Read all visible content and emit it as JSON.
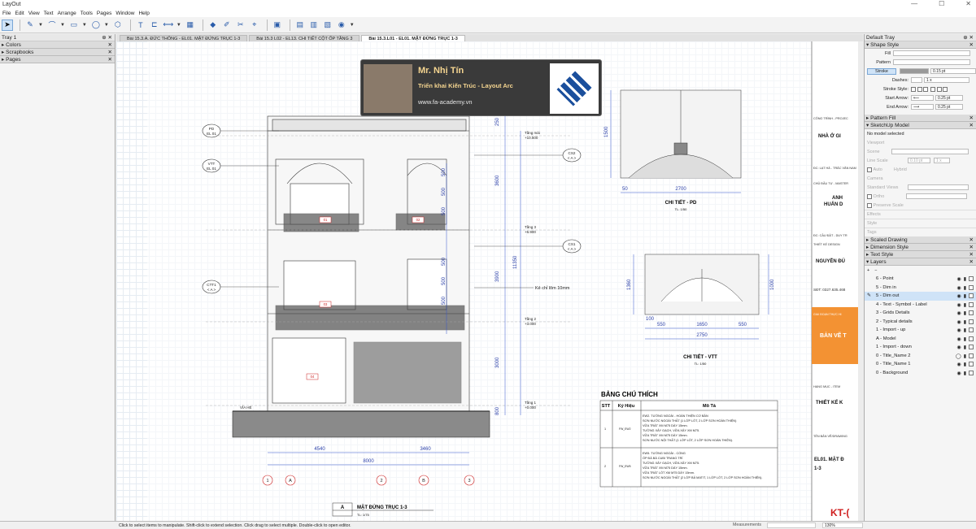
{
  "app": {
    "title": "LayOut",
    "min": "—",
    "max": "☐",
    "close": "✕"
  },
  "menu": [
    "File",
    "Edit",
    "View",
    "Text",
    "Arrange",
    "Tools",
    "Pages",
    "Window",
    "Help"
  ],
  "tray1": {
    "title": "Tray 1",
    "panels": [
      "Colors",
      "Scrapbooks",
      "Pages"
    ]
  },
  "tabs": [
    "Bài 15.3.A. ĐỨC THÔNG - EL01. MẶT ĐỨNG TRỤC 1-3",
    "Bài 15.3 L02 - EL13. CHI TIẾT CỘT ỐP TẦNG 3",
    "Bài 15.3.L01 - EL01. MẶT ĐỨNG TRỤC 1-3"
  ],
  "banner": {
    "name": "Mr. Nhị Tín",
    "role": "Triển khai Kiến Trúc - Layout Arc",
    "site": "www.fa-academy.vn"
  },
  "drawing": {
    "grid_bubbles": [
      {
        "label": "PD",
        "sub": "EL 01"
      },
      {
        "label": "VTT",
        "sub": "EL 01"
      },
      {
        "label": "CTT1",
        "sub": "< A >"
      },
      {
        "label": "CS2",
        "sub": "< A >"
      },
      {
        "label": "CS1",
        "sub": "< A >"
      }
    ],
    "levels": [
      {
        "name": "Tầng mái",
        "val": "+10.500"
      },
      {
        "name": "Tầng 3",
        "val": "+6.900"
      },
      {
        "name": "Tầng 2",
        "val": "+3.000"
      },
      {
        "name": "Tầng 1",
        "val": "+0.000"
      }
    ],
    "vertical_dims": [
      "3600",
      "3900",
      "3000",
      "800",
      "11350",
      "250"
    ],
    "window_dims": [
      "500",
      "500",
      "500",
      "500",
      "500",
      "500"
    ],
    "bottom_dims": [
      "4540",
      "3460",
      "8000"
    ],
    "axes": [
      "1",
      "A",
      "2",
      "B",
      "3"
    ],
    "tags": [
      "01",
      "02",
      "03",
      "04"
    ],
    "callout": "Kẻ chỉ lõm 10mm",
    "via_he": "VỈA HÈ",
    "title_block": {
      "letter": "A",
      "name": "MẶT ĐỨNG TRỤC 1-3",
      "scale": "TL: 1/75"
    },
    "pd": {
      "dim_h": "2700",
      "dim_v": "1500",
      "dim_l": "50",
      "title": "CHI TIẾT - PD",
      "scale": "TL: 1/50"
    },
    "vtt": {
      "dims": [
        "550",
        "1650",
        "550"
      ],
      "total": "2750",
      "dim_v": "1360",
      "dim_r": "1000",
      "dim_b": "100",
      "title": "CHI TIẾT - VTT",
      "scale": "TL: 1/50"
    },
    "legend": {
      "title": "BẢNG CHÚ THÍCH",
      "headers": [
        "STT",
        "Ký Hiệu",
        "Mô Tả"
      ],
      "rows": [
        {
          "stt": "1",
          "code": "FW_EW2",
          "lines": [
            "EW2. TƯỜNG NGOÀI - HOÀN THIỆN CƠ BẢN",
            "SƠN NƯỚC NGOÀI THẤT (1 LỚP LÓT, 2 LỚP SƠN HOÀN THIỆN)",
            "VỮA TRÁT XM M75 DÀY 15mm.",
            "TƯỜNG XÂY GẠCH, VỮA XÂY XM M75.",
            "VỮA TRÁT XM M75 DÀY 15mm.",
            "SƠN NƯỚC NỘI THẤT (1 LỚP LÓT, 2 LỚP SƠN HOÀN THIỆN)."
          ]
        },
        {
          "stt": "2",
          "code": "FW_EW5",
          "lines": [
            "EW5. TƯỜNG NGOÀI - CỔNG",
            "ỐP ĐÁ BÁ CUBI TRANG TRÍ",
            "TƯỜNG XÂY GẠCH, VỮA XÂY XM M75.",
            "VỮA TRÁT XM M75 DÀY 15mm.",
            "VỮA TRÁT LÓT XM M75 DÀY 15mm.",
            "SƠN NƯỚC NGOÀI THẤT (2 LỚP BẢ MATIT, 1 LỚP LÓT, 2 LỚP SƠN HOÀN THIỆN)."
          ]
        }
      ]
    },
    "sheet": {
      "cong_trinh": "CÔNG TRÌNH - PROJEC",
      "nha": "NHÀ Ở GI",
      "addr": "ĐC: LẠT HÀ - TRẮC VĂN NAM",
      "chu_dau_tu": "CHỦ ĐẦU TƯ - MASTER",
      "anh": "ANH",
      "huan": "HUẤN D",
      "dc2": "ĐC: CẦU ĐẬT - DUY TR",
      "tkdesign": "THIẾT KẾ DESIGN",
      "nguyen": "NGUYỄN ĐÚ",
      "sdt": "SĐT: 0327.635.468",
      "giai_doan": "GIAI ĐOẠN THỰC HI",
      "ban_ve": "BẢN VẼ T",
      "hang_muc": "HẠNG MỤC - ITEM",
      "tk": "THIẾT KẾ K",
      "ten_ban_ve": "TÊN BẢN VẼ/DRAWING",
      "el01": "EL01. MẶT Đ",
      "el01b": "1-3",
      "kt": "KT-("
    }
  },
  "tray2": {
    "title": "Default Tray",
    "shape_style": "Shape Style",
    "fill": "Fill",
    "pattern": "Pattern",
    "stroke": "Stroke",
    "stroke_w": "0.15 pt",
    "dashes": "Dashes:",
    "dash_v": "1 x",
    "stroke_style": "Stroke Style:",
    "start_arrow": "Start Arrow:",
    "start_v": "0.25 pt",
    "end_arrow": "End Arrow:",
    "end_v": "0.25 pt",
    "pattern_fill": "Pattern Fill",
    "sketchup_model": "SketchUp Model",
    "no_model": "No model selected",
    "viewport": "Viewport",
    "scene": "Scene",
    "line_scale": "Line Scale",
    "ls_v": "0.10 pt",
    "ls_x": "1 x",
    "auto": "Auto",
    "hybrid": "Hybrid",
    "camera": "Camera",
    "std_views": "Standard Views",
    "ortho": "Ortho",
    "preserve": "Preserve Scale",
    "effects": "Effects",
    "style": "Style",
    "tags": "Tags",
    "scaled": "Scaled Drawing",
    "dimension": "Dimension Style",
    "text": "Text Style",
    "layers": "Layers",
    "layer_list": [
      "6 - Point",
      "5 - Dim in",
      "5 - Dim out",
      "4 - Text - Symbol - Label",
      "3 - Grids Details",
      "2 - Typical details",
      "1 - Import - up",
      "A - Model",
      "1 - Import - down",
      "0 - Title_Name 2",
      "0 - Title_Name 1",
      "0 - Background"
    ]
  },
  "status": {
    "hint": "Click to select items to manipulate. Shift-click to extend selection. Click drag to select multiple. Double-click to open editor.",
    "meas": "Measurements",
    "zoom": "130%"
  }
}
